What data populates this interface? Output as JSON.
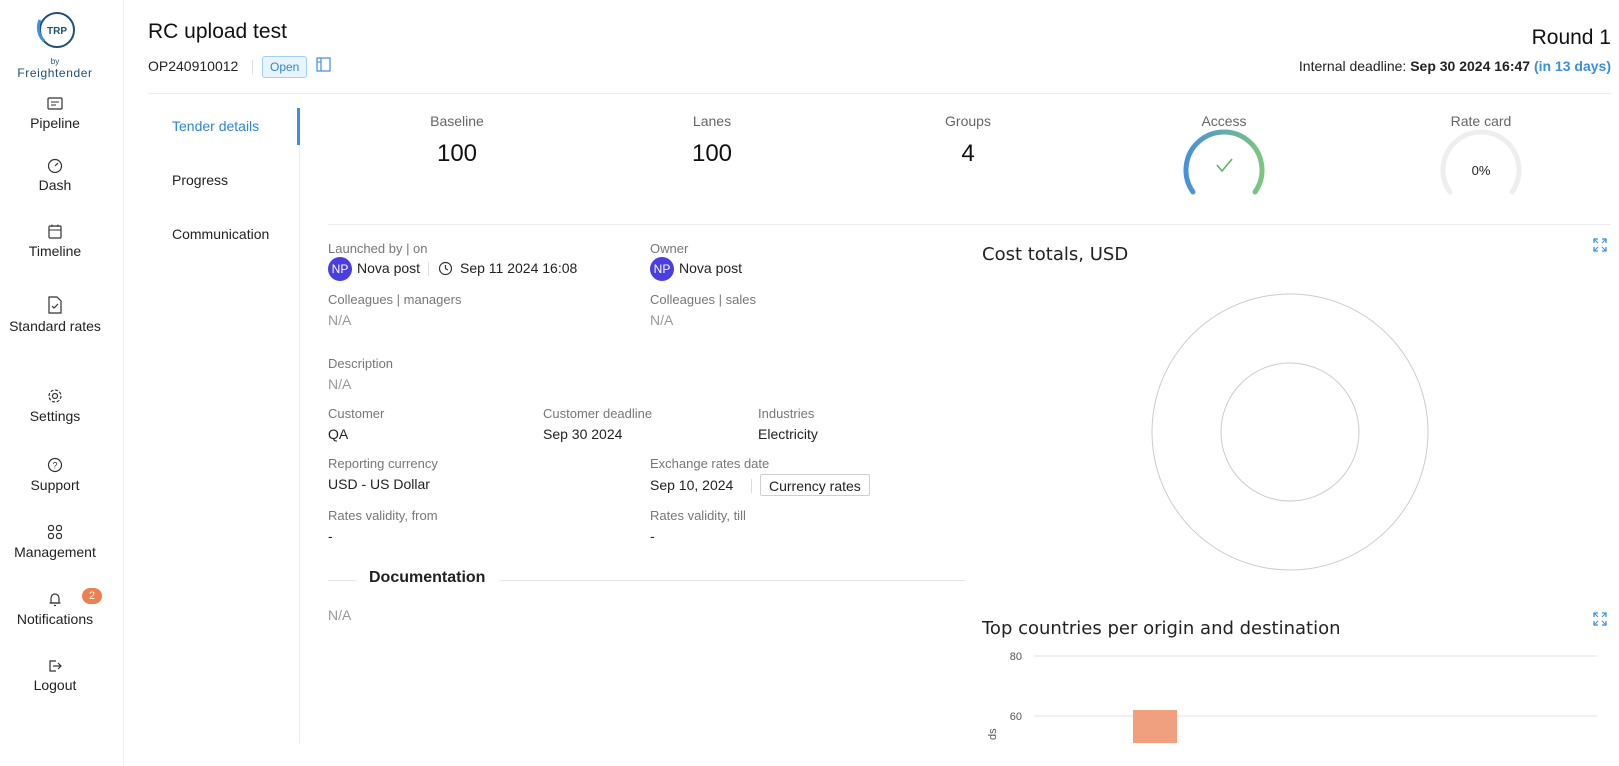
{
  "sidebar": {
    "logo_mark": "TRP",
    "logo_by": "by",
    "logo_brand": "Freightender",
    "items": [
      {
        "label": "Pipeline",
        "icon": "pipeline-icon"
      },
      {
        "label": "Dash",
        "icon": "dashboard-gauge-icon"
      },
      {
        "label": "Timeline",
        "icon": "calendar-icon"
      },
      {
        "label": "Standard rates",
        "icon": "file-check-icon"
      },
      {
        "label": "Settings",
        "icon": "gear-icon"
      },
      {
        "label": "Support",
        "icon": "question-circle-icon"
      },
      {
        "label": "Management",
        "icon": "grid-icon"
      },
      {
        "label": "Notifications",
        "icon": "bell-icon"
      },
      {
        "label": "Logout",
        "icon": "logout-icon"
      }
    ],
    "notification_count": "2"
  },
  "header": {
    "title": "RC upload test",
    "code": "OP240910012",
    "status": "Open",
    "round": "Round 1",
    "deadline_label": "Internal deadline:",
    "deadline_value": "Sep 30 2024 16:47",
    "deadline_relative": "(in 13 days)"
  },
  "tabs": [
    {
      "label": "Tender details",
      "active": true
    },
    {
      "label": "Progress",
      "active": false
    },
    {
      "label": "Communication",
      "active": false
    }
  ],
  "stats": {
    "baseline": {
      "label": "Baseline",
      "value": "100"
    },
    "lanes": {
      "label": "Lanes",
      "value": "100"
    },
    "groups": {
      "label": "Groups",
      "value": "4"
    },
    "access": {
      "label": "Access",
      "icon": "check-icon",
      "level": 1.0,
      "colors": [
        "#4a90d9",
        "#7bc67e"
      ]
    },
    "rate_card": {
      "label": "Rate card",
      "value": "0%",
      "level": 0.0
    }
  },
  "details": {
    "launched_label": "Launched by | on",
    "launched_avatar": "NP",
    "launched_by": "Nova post",
    "launched_on": "Sep 11 2024 16:08",
    "owner_label": "Owner",
    "owner_avatar": "NP",
    "owner": "Nova post",
    "colleagues_managers_label": "Colleagues | managers",
    "colleagues_managers": "N/A",
    "colleagues_sales_label": "Colleagues | sales",
    "colleagues_sales": "N/A",
    "description_label": "Description",
    "description": "N/A",
    "customer_label": "Customer",
    "customer": "QA",
    "customer_deadline_label": "Customer deadline",
    "customer_deadline": "Sep 30 2024",
    "industries_label": "Industries",
    "industries": "Electricity",
    "reporting_currency_label": "Reporting currency",
    "reporting_currency": "USD - US Dollar",
    "exchange_rates_date_label": "Exchange rates date",
    "exchange_rates_date": "Sep 10, 2024",
    "currency_rates_button": "Currency rates",
    "validity_from_label": "Rates validity, from",
    "validity_from": "-",
    "validity_till_label": "Rates validity, till",
    "validity_till": "-",
    "documentation_title": "Documentation",
    "documentation": "N/A"
  },
  "cost_chart": {
    "title": "Cost totals, USD"
  },
  "countries_chart": {
    "title": "Top countries per origin and destination",
    "ylabel_fragment": "ds",
    "accent": "#f0a07e"
  },
  "chart_data": [
    {
      "type": "pie",
      "title": "Cost totals, USD",
      "values": []
    },
    {
      "type": "bar",
      "title": "Top countries per origin and destination",
      "ylabel": "ds",
      "yticks": [
        60,
        80
      ],
      "series": [
        {
          "values": [
            62
          ]
        }
      ]
    }
  ]
}
